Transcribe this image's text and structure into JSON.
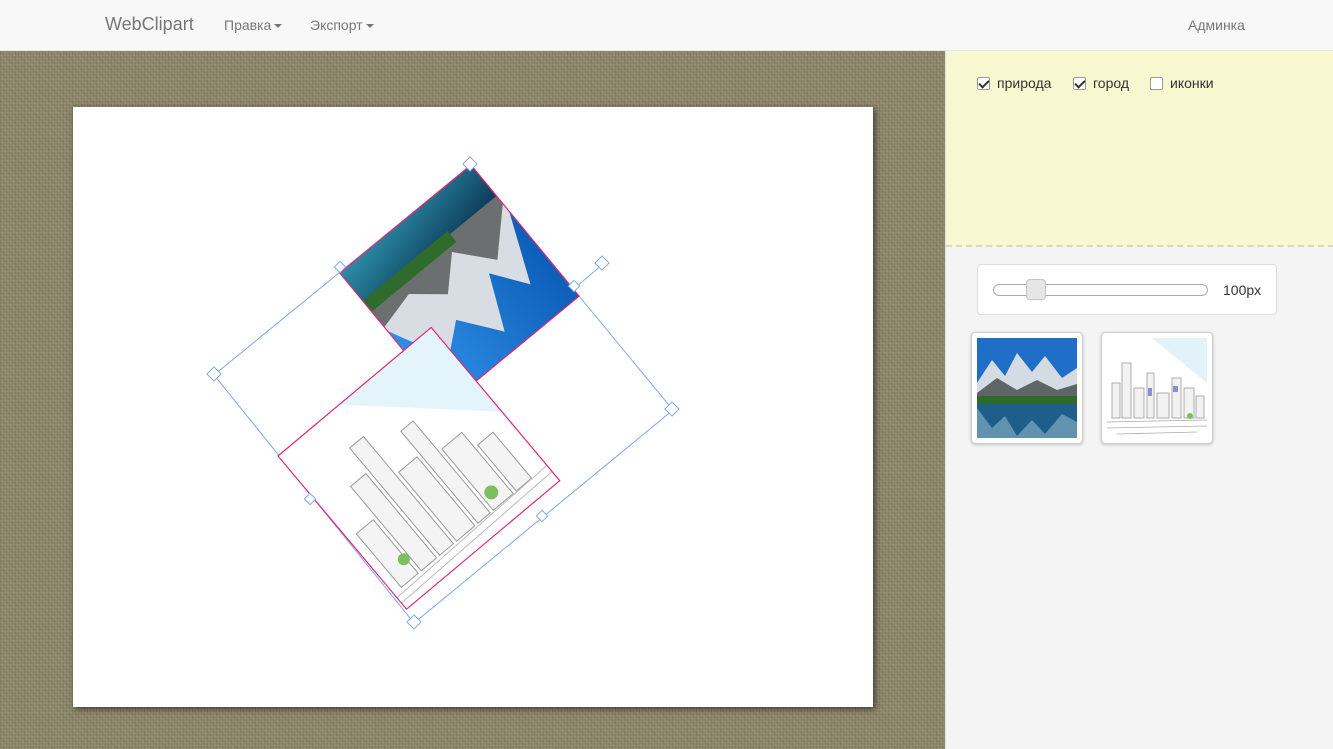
{
  "navbar": {
    "brand": "WebClipart",
    "menu_edit": "Правка",
    "menu_export": "Экспорт",
    "admin": "Админка"
  },
  "filters": [
    {
      "label": "природа",
      "checked": true
    },
    {
      "label": "город",
      "checked": true
    },
    {
      "label": "иконки",
      "checked": false
    }
  ],
  "size_slider": {
    "value_label": "100px",
    "value": 100
  },
  "thumbnails": [
    {
      "name": "nature-mountain-lake",
      "icon": "mountain-lake-image"
    },
    {
      "name": "city-sketch",
      "icon": "city-sketch-image"
    }
  ],
  "canvas_objects": [
    {
      "type": "image",
      "content": "mountain-lake",
      "selected": true
    },
    {
      "type": "image",
      "content": "city-sketch",
      "selected": true
    }
  ],
  "colors": {
    "selection_border": "#e0267a",
    "selection_handles": "#7fa8f0",
    "filters_bg": "#f8f8d0"
  }
}
